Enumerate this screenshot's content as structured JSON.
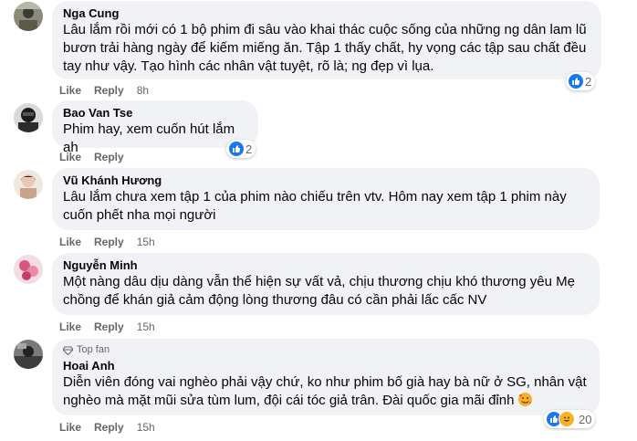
{
  "actions": {
    "like": "Like",
    "reply": "Reply"
  },
  "comments": [
    {
      "author": "Nga Cung",
      "text": "Lâu lắm rồi mới có 1 bộ phim đi sâu vào khai thác cuộc sống của những ng dân lam lũ\nbươn trải hàng ngày để kiếm miếng ăn. Tập 1 thấy chất, hy vọng các tập sau chất đều\ntay như vậy. Tạo hình các nhân vật tuyệt, rõ là; ng đẹp vì lụa.",
      "time": "8h",
      "reaction_count": "2"
    },
    {
      "author": "Bao Van Tse",
      "text": "Phim hay, xem cuốn hút lắm ah",
      "time": "",
      "reaction_count": "2"
    },
    {
      "author": "Vũ Khánh Hương",
      "text": "Lâu lắm chưa xem tập 1 của phim nào chiếu trên vtv. Hôm nay xem tập 1 phim này\ncuốn phết nha mọi người",
      "time": "15h"
    },
    {
      "author": "Nguyễn Minh",
      "text": "Một nàng dâu dịu dàng vẫn thể hiện sự vất vả, chịu thương chịu khó thương yêu Mẹ\nchồng để khán giả cảm động lòng thương đâu có cần phải lấc cấc NV",
      "time": "15h"
    },
    {
      "badge": "Top fan",
      "author": "Hoai Anh",
      "text": "Diễn viên đóng vai nghèo phải vậy chứ, ko như phim bố già hay bà nữ ở SG, nhân vật\nnghèo mà mặt mũi sửa tùm lum, đội cái tóc giả trân. Đài quốc gia mãi đỉnh",
      "time": "15h",
      "reaction_count": "20"
    }
  ],
  "colors": {
    "bubble": "#f0f2f5",
    "like_blue": "#1877f2",
    "meta_gray": "#65676b"
  }
}
